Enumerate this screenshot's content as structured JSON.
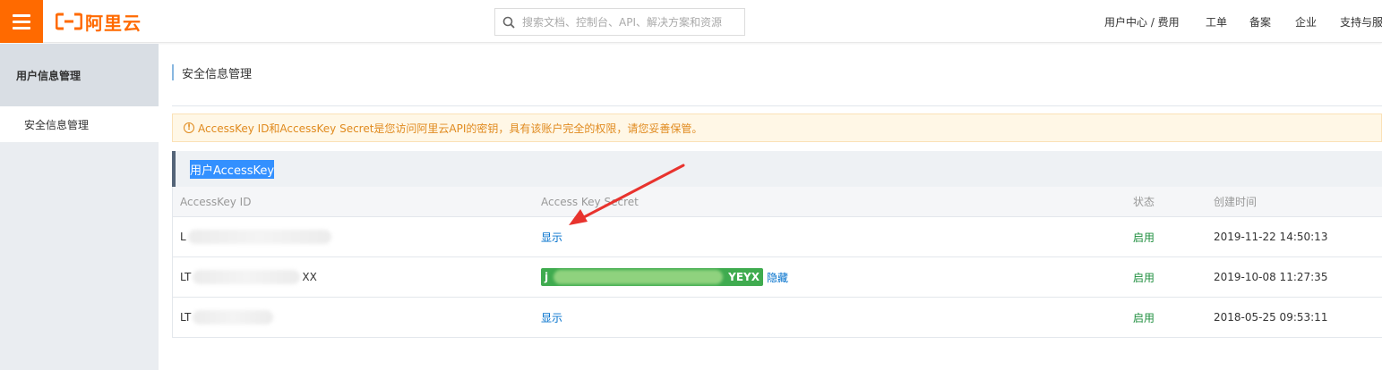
{
  "header": {
    "logo_text": "阿里云",
    "search_placeholder": "搜索文档、控制台、API、解决方案和资源",
    "nav": [
      "用户中心 / 费用",
      "工单",
      "备案",
      "企业",
      "支持与服"
    ],
    "brand_color": "#ff6a00"
  },
  "sidebar": {
    "title": "用户信息管理",
    "items": [
      {
        "label": "安全信息管理"
      }
    ]
  },
  "main": {
    "breadcrumb": "安全信息管理",
    "notice": "AccessKey ID和AccessKey Secret是您访问阿里云API的密钥，具有该账户完全的权限，请您妥善保管。",
    "panel_title": "用户AccessKey",
    "table": {
      "columns": [
        "AccessKey ID",
        "Access Key Secret",
        "状态",
        "创建时间"
      ],
      "rows": [
        {
          "id_prefix": "L",
          "id_suffix": "",
          "secret_action": "显示",
          "status": "启用",
          "created": "2019-11-22 14:50:13"
        },
        {
          "id_prefix": "LT",
          "id_suffix": "XX",
          "secret_prefix": "j",
          "secret_suffix": "YEYX",
          "secret_action": "隐藏",
          "status": "启用",
          "created": "2019-10-08 11:27:35"
        },
        {
          "id_prefix": "LT",
          "id_suffix": "",
          "secret_action": "显示",
          "status": "启用",
          "created": "2018-05-25 09:53:11"
        }
      ]
    }
  }
}
